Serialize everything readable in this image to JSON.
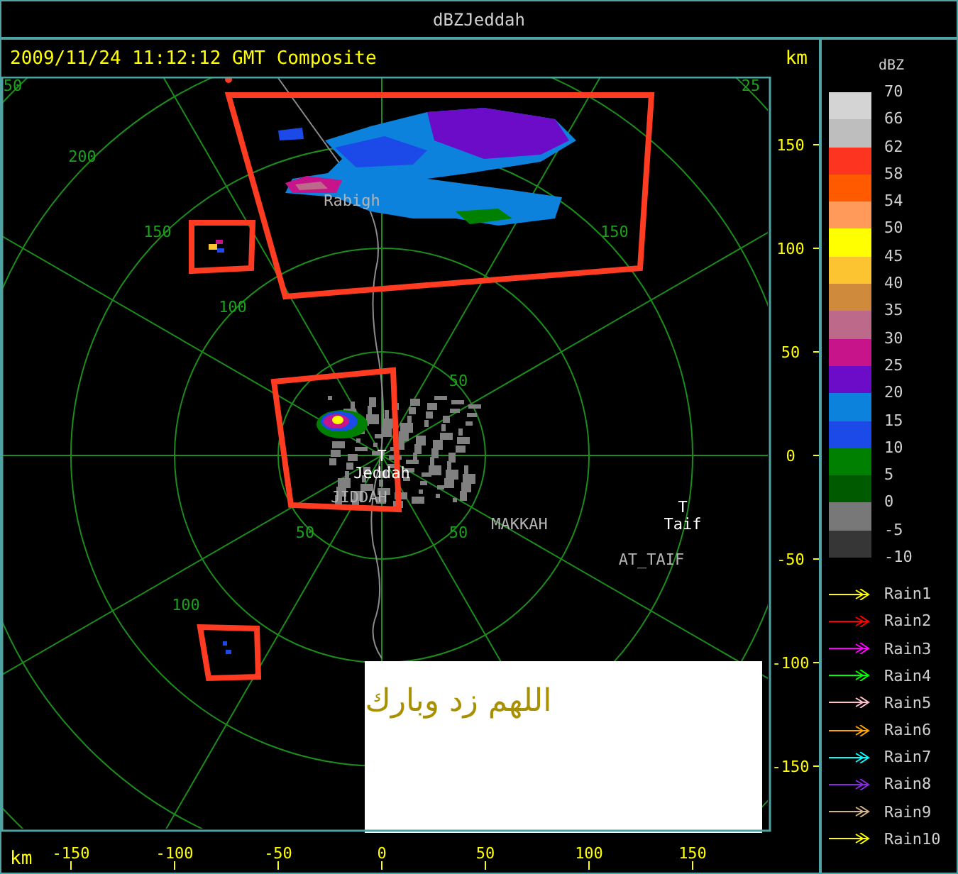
{
  "window": {
    "title": "dBZJeddah"
  },
  "header": {
    "title": "2009/11/24 11:12:12 GMT Composite",
    "unit": "km"
  },
  "plot": {
    "ring_labels": [
      {
        "text": "50"
      },
      {
        "text": "25"
      },
      {
        "text": "200"
      },
      {
        "text": "150"
      },
      {
        "text": "100"
      },
      {
        "text": "150"
      },
      {
        "text": "50"
      },
      {
        "text": "50"
      },
      {
        "text": "50"
      },
      {
        "text": "100"
      }
    ],
    "places": [
      {
        "name": "Rabigh",
        "kind": "map_label"
      },
      {
        "name": "Jeddah",
        "kind": "site",
        "marker": "T"
      },
      {
        "name": "JIDDAH",
        "kind": "map_label"
      },
      {
        "name": "MAKKAH",
        "kind": "map_label"
      },
      {
        "name": "Taif",
        "kind": "site",
        "marker": "T"
      },
      {
        "name": "AT_TAIF",
        "kind": "map_label"
      }
    ],
    "overlay_text": "اللهم زد وبارك",
    "y_axis": {
      "ticks": [
        "150",
        "100",
        "50",
        "0",
        "-50",
        "-100",
        "-150"
      ]
    },
    "x_axis": {
      "unit": "km",
      "ticks": [
        "-150",
        "-100",
        "-50",
        "0",
        "50",
        "100",
        "150"
      ]
    }
  },
  "legend": {
    "title": "dBZ",
    "levels": [
      {
        "label": "70",
        "color": "#d4d4d4"
      },
      {
        "label": "66",
        "color": "#bebebe"
      },
      {
        "label": "62",
        "color": "#fc3420"
      },
      {
        "label": "58",
        "color": "#ff5a00"
      },
      {
        "label": "54",
        "color": "#ff9a5a"
      },
      {
        "label": "50",
        "color": "#ffff00"
      },
      {
        "label": "45",
        "color": "#fcc431"
      },
      {
        "label": "40",
        "color": "#d08a3c"
      },
      {
        "label": "35",
        "color": "#bd6a8a"
      },
      {
        "label": "30",
        "color": "#c8148a"
      },
      {
        "label": "25",
        "color": "#6c0cc8"
      },
      {
        "label": "20",
        "color": "#0c82dc"
      },
      {
        "label": "15",
        "color": "#1c4ae8"
      },
      {
        "label": "10",
        "color": "#008000"
      },
      {
        "label": "5",
        "color": "#005a00"
      },
      {
        "label": "0",
        "color": "#787878"
      },
      {
        "label": "-5",
        "color": "#363636"
      }
    ],
    "bottom_label": "-10",
    "rain_tracks": [
      {
        "label": "Rain1",
        "color": "#ffff00"
      },
      {
        "label": "Rain2",
        "color": "#ff0000"
      },
      {
        "label": "Rain3",
        "color": "#ff00ff"
      },
      {
        "label": "Rain4",
        "color": "#00ff00"
      },
      {
        "label": "Rain5",
        "color": "#ffc0cb"
      },
      {
        "label": "Rain6",
        "color": "#ffa500"
      },
      {
        "label": "Rain7",
        "color": "#00ffff"
      },
      {
        "label": "Rain8",
        "color": "#8a2be2"
      },
      {
        "label": "Rain9",
        "color": "#d2b48c"
      },
      {
        "label": "Rain10",
        "color": "#ffff00"
      }
    ]
  }
}
